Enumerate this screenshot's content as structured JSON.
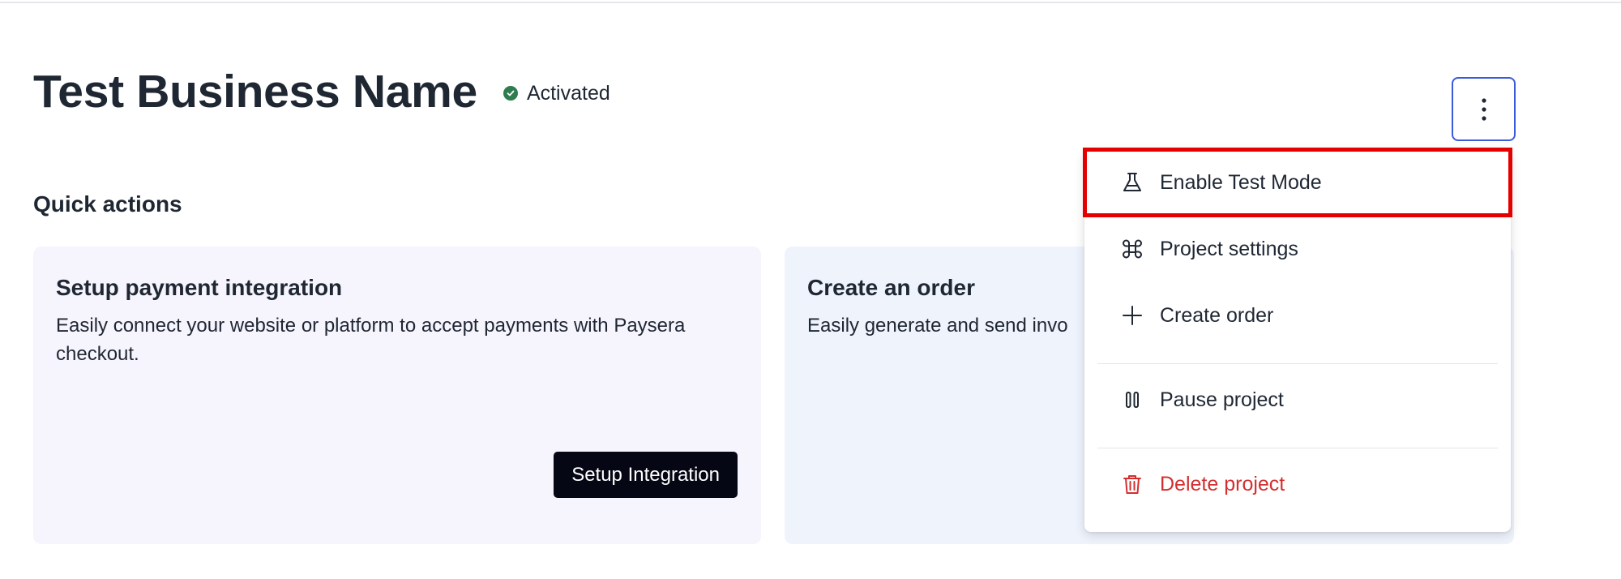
{
  "header": {
    "title": "Test Business Name",
    "status": "Activated",
    "status_color": "#2e7d4f",
    "more_icon": "vertical-dots-icon"
  },
  "quick_actions": {
    "title": "Quick actions",
    "cards": [
      {
        "title": "Setup payment integration",
        "description": "Easily connect your website or platform to accept payments with Paysera checkout.",
        "button": "Setup Integration"
      },
      {
        "title": "Create an order",
        "description": "Easily generate and send invo"
      }
    ]
  },
  "menu": {
    "items": [
      {
        "label": "Enable Test Mode",
        "icon": "flask-icon"
      },
      {
        "label": "Project settings",
        "icon": "command-icon"
      },
      {
        "label": "Create order",
        "icon": "plus-icon"
      },
      {
        "label": "Pause project",
        "icon": "pause-icon"
      },
      {
        "label": "Delete project",
        "icon": "trash-icon",
        "color": "#d32f2f"
      }
    ],
    "highlight_color": "#e50000"
  }
}
